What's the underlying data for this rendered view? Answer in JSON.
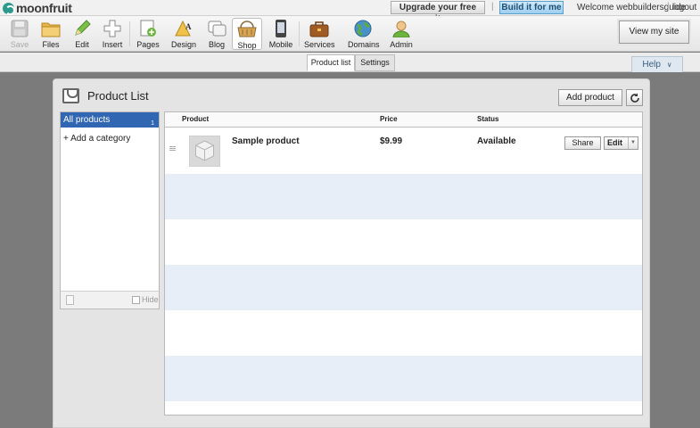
{
  "topbar": {
    "brand": "moonfruit",
    "upgrade_label": "Upgrade your free site",
    "separator": "|",
    "build_label": "Build it for me",
    "welcome_text": "Welcome webbuildersguide",
    "logout_separator": "|",
    "logout_label": "logout"
  },
  "toolbar": {
    "items": [
      {
        "label": "Save",
        "icon": "save-icon",
        "disabled": true
      },
      {
        "label": "Files",
        "icon": "folder-icon"
      },
      {
        "label": "Edit",
        "icon": "pencil-icon"
      },
      {
        "label": "Insert",
        "icon": "plus-icon"
      },
      {
        "label": "Pages",
        "icon": "pages-icon"
      },
      {
        "label": "Design",
        "icon": "design-icon"
      },
      {
        "label": "Blog",
        "icon": "blog-icon"
      },
      {
        "label": "Shop",
        "icon": "basket-icon",
        "active": true
      },
      {
        "label": "Mobile",
        "icon": "mobile-icon"
      },
      {
        "label": "Services",
        "icon": "briefcase-icon"
      },
      {
        "label": "Domains",
        "icon": "globe-icon"
      },
      {
        "label": "Admin",
        "icon": "user-icon"
      }
    ],
    "view_site_label": "View my site"
  },
  "subnav": {
    "tabs": [
      {
        "label": "Product list",
        "active": true
      },
      {
        "label": "Settings",
        "active": false
      }
    ],
    "help_label": "Help",
    "help_caret": "∨"
  },
  "panel": {
    "title": "Product List",
    "add_product_label": "Add product",
    "categories": {
      "all_label": "All products",
      "all_count": "1",
      "add_category_label": "+ Add a category",
      "hide_label": "Hide"
    },
    "table": {
      "columns": [
        "Product",
        "Price",
        "Status"
      ],
      "products": [
        {
          "name": "Sample product",
          "price": "$9.99",
          "status": "Available",
          "share_label": "Share",
          "edit_label": "Edit",
          "edit_caret": "▼"
        }
      ]
    }
  },
  "colors": {
    "selected_category": "#3167b2",
    "alt_row": "#e7eef7",
    "build_button": "#9dcff0",
    "brand": "#2d9a8e"
  }
}
